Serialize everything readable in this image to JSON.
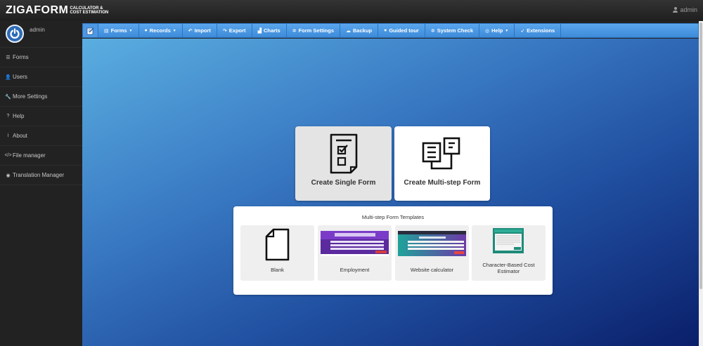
{
  "brand": {
    "name": "ZIGAFORM",
    "subtitle_line1": "CALCULATOR &",
    "subtitle_line2": "COST ESTIMATION"
  },
  "top_user": {
    "label": "admin"
  },
  "sidebar": {
    "profile_name": "admin",
    "items": [
      {
        "label": "Forms",
        "icon": "list-icon"
      },
      {
        "label": "Users",
        "icon": "user-icon"
      },
      {
        "label": "More Settings",
        "icon": "wrench-icon"
      },
      {
        "label": "Help",
        "icon": "question-icon"
      },
      {
        "label": "About",
        "icon": "info-icon"
      },
      {
        "label": "File manager",
        "icon": "code-icon"
      },
      {
        "label": "Translation Manager",
        "icon": "globe-icon"
      }
    ]
  },
  "toolbar": {
    "items": [
      {
        "label": "Forms",
        "icon": "file-icon",
        "dropdown": true
      },
      {
        "label": "Records",
        "icon": "info-circle-icon",
        "dropdown": true
      },
      {
        "label": "Import",
        "icon": "undo-icon",
        "dropdown": false
      },
      {
        "label": "Export",
        "icon": "share-icon",
        "dropdown": false
      },
      {
        "label": "Charts",
        "icon": "chart-icon",
        "dropdown": false
      },
      {
        "label": "Form Settings",
        "icon": "gear-icon",
        "dropdown": false
      },
      {
        "label": "Backup",
        "icon": "cloud-icon",
        "dropdown": false
      },
      {
        "label": "Guided tour",
        "icon": "question-circle-icon",
        "dropdown": false
      },
      {
        "label": "System Check",
        "icon": "cog-icon",
        "dropdown": false
      },
      {
        "label": "Help",
        "icon": "lifebuoy-icon",
        "dropdown": true
      },
      {
        "label": "Extensions",
        "icon": "rocket-icon",
        "dropdown": false
      }
    ]
  },
  "cards": {
    "single": "Create Single Form",
    "multi": "Create Multi-step Form"
  },
  "templates": {
    "heading": "Multi-step Form Templates",
    "items": [
      {
        "label": "Blank"
      },
      {
        "label": "Employment"
      },
      {
        "label": "Website calculator"
      },
      {
        "label": "Character-Based Cost Estimator"
      }
    ]
  },
  "colors": {
    "toolbar": "#4a97e6",
    "sidebar": "#222222",
    "canvas_start": "#5aaee0",
    "canvas_end": "#0a1f6a"
  }
}
